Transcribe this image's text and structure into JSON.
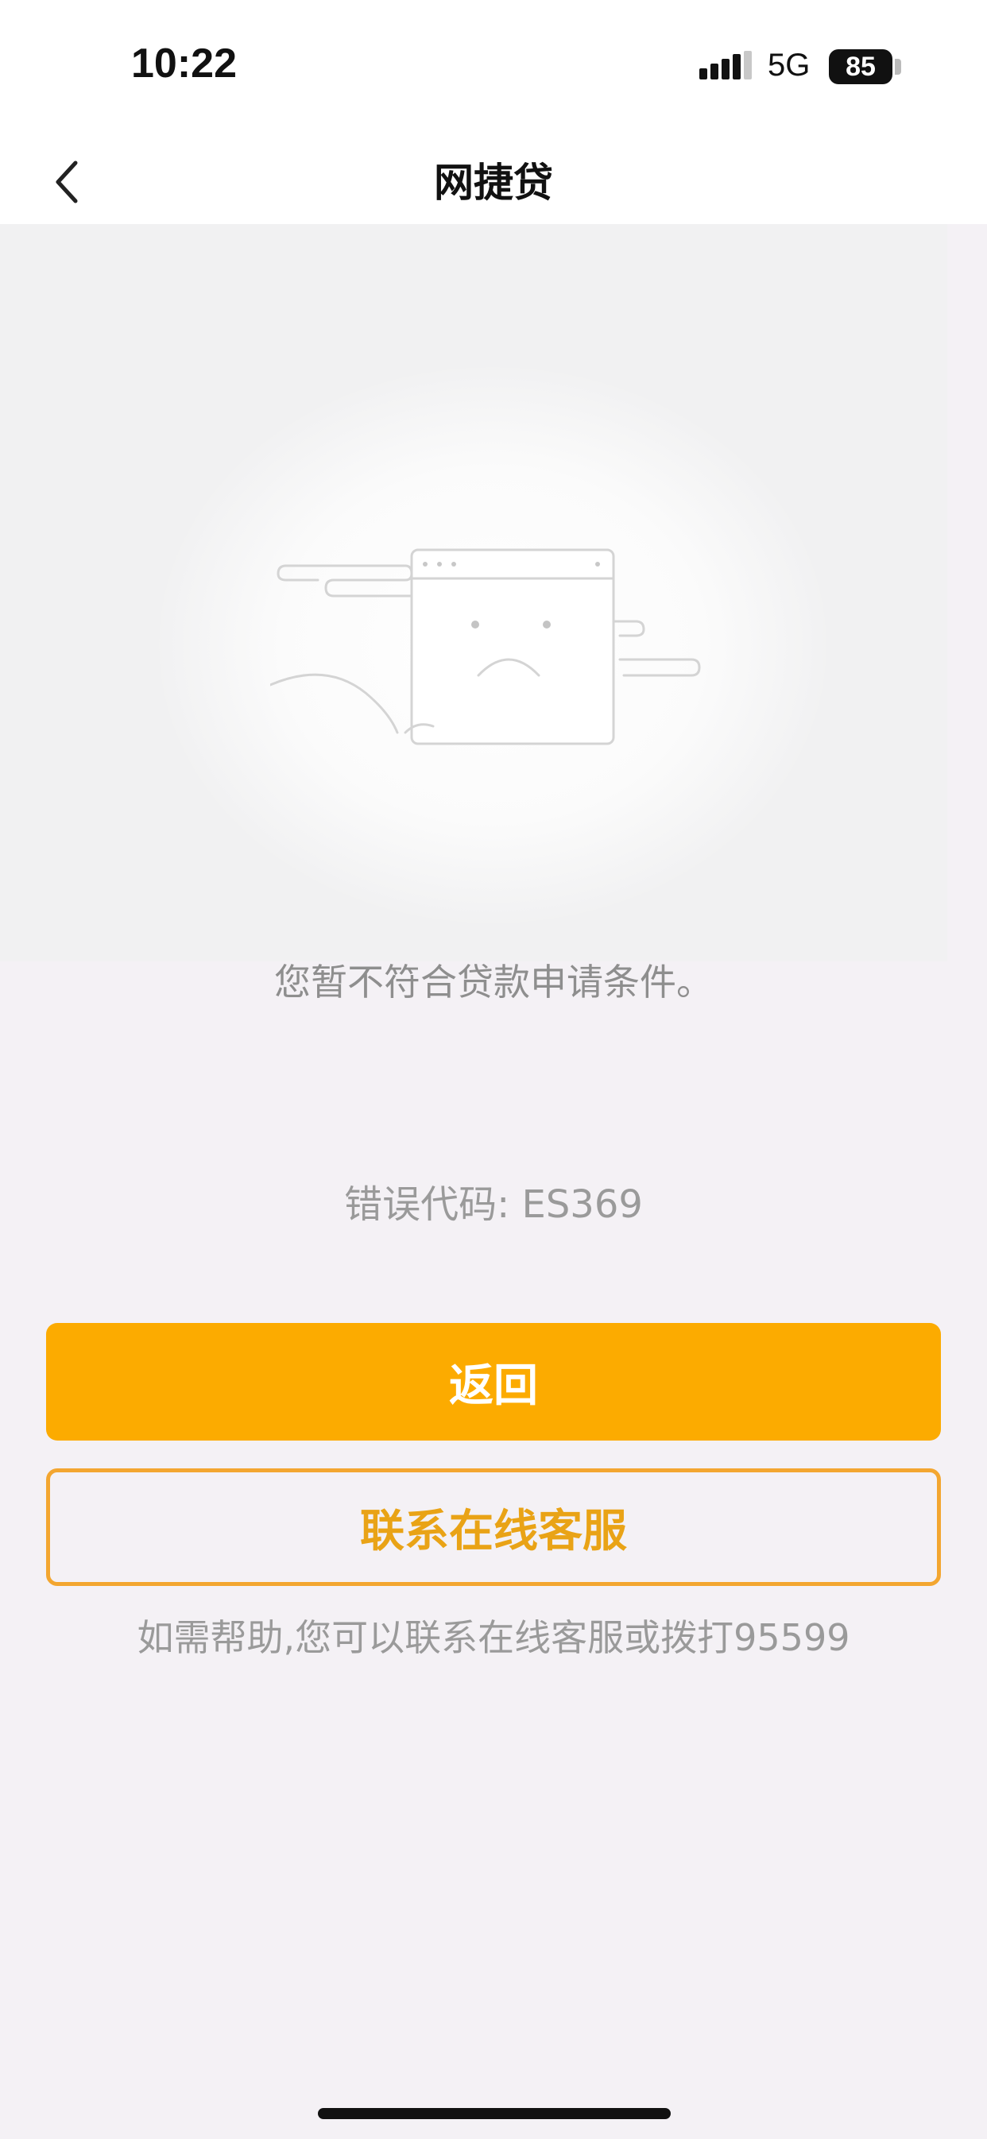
{
  "status_bar": {
    "time": "10:22",
    "network": "5G",
    "battery": "85",
    "signal_icon": "cellular-signal-icon"
  },
  "nav": {
    "back_icon": "chevron-left-icon",
    "title": "网捷贷"
  },
  "illustration": {
    "icon": "sad-browser-window-illustration"
  },
  "content": {
    "message": "您暂不符合贷款申请条件。",
    "error_code": "错误代码: ES369"
  },
  "actions": {
    "back_label": "返回",
    "contact_label": "联系在线客服"
  },
  "help": {
    "text": "如需帮助,您可以联系在线客服或拨打95599"
  },
  "colors": {
    "accent": "#fcab00",
    "outline": "#f3a630",
    "outline_text": "#e9a316"
  }
}
